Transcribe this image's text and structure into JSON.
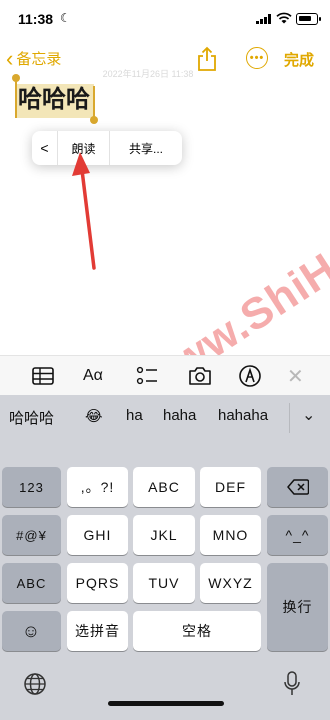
{
  "status_bar": {
    "time": "11:38",
    "moon": "☾"
  },
  "nav": {
    "back_label": "备忘录",
    "back_chevron": "‹",
    "date_text": "2022年11月26日 11:38",
    "more_glyph": "•••",
    "done_label": "完成"
  },
  "note": {
    "text": "哈哈哈"
  },
  "edit_menu": {
    "back": "<",
    "read_aloud": "朗读",
    "share": "共享..."
  },
  "watermark": "适会说 www.ShiHuiShuo.Com",
  "toolbar": {
    "format": "Aα",
    "close": "✕"
  },
  "keyboard": {
    "candidates": [
      "哈哈哈",
      "😂",
      "ha",
      "haha",
      "hahaha"
    ],
    "expand": "⌄",
    "keys": {
      "k123": "123",
      "punct": ",。?!",
      "abc_key": "ABC",
      "def": "DEF",
      "symbols": "#@¥",
      "ghi": "GHI",
      "jkl": "JKL",
      "mno": "MNO",
      "face": "^_^",
      "abc": "ABC",
      "pqrs": "PQRS",
      "tuv": "TUV",
      "wxyz": "WXYZ",
      "enter": "换行",
      "emoji": "☺",
      "pinyin": "选拼音",
      "space": "空格"
    }
  },
  "colors": {
    "accent": "#e0a800",
    "arrow": "#e23b35",
    "watermark": "#e84646"
  }
}
